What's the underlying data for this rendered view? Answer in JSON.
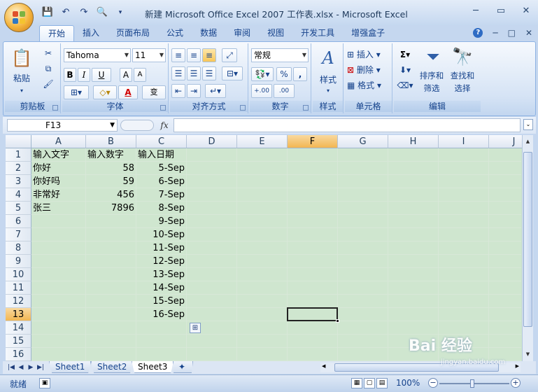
{
  "window": {
    "title": "新建 Microsoft Office Excel 2007 工作表.xlsx - Microsoft Excel",
    "min": "─",
    "max": "▭",
    "close": "✕"
  },
  "qat": [
    "save-icon",
    "undo-icon",
    "redo-icon",
    "preview-icon",
    "customize-icon"
  ],
  "tabs": [
    "开始",
    "插入",
    "页面布局",
    "公式",
    "数据",
    "审阅",
    "视图",
    "开发工具",
    "增强盒子"
  ],
  "ribbon_right": {
    "help": "?",
    "min": "─",
    "restore": "□",
    "close": "✕"
  },
  "ribbon": {
    "clipboard": {
      "label": "剪贴板",
      "paste": "粘贴"
    },
    "font": {
      "label": "字体",
      "name": "Tahoma",
      "size": "11",
      "bold": "B",
      "italic": "I",
      "underline": "U",
      "grow": "A",
      "shrink": "A",
      "color_a": "A",
      "phonetic": "变"
    },
    "alignment": {
      "label": "对齐方式"
    },
    "number": {
      "label": "数字",
      "format": "常规",
      "percent": "%",
      "comma": ",",
      "inc": ".00",
      "dec": ".00"
    },
    "styles": {
      "label": "样式"
    },
    "cells": {
      "label": "单元格",
      "insert": "插入",
      "delete": "删除",
      "format": "格式"
    },
    "editing": {
      "label": "编辑",
      "sort": "排序和",
      "sort2": "筛选",
      "find": "查找和",
      "find2": "选择"
    }
  },
  "formula_bar": {
    "name_box": "F13",
    "fx": "fx",
    "formula": ""
  },
  "columns": [
    "A",
    "B",
    "C",
    "D",
    "E",
    "F",
    "G",
    "H",
    "I",
    "J"
  ],
  "rows": [
    "1",
    "2",
    "3",
    "4",
    "5",
    "6",
    "7",
    "8",
    "9",
    "10",
    "11",
    "12",
    "13",
    "14",
    "15",
    "16"
  ],
  "selected": {
    "col": "F",
    "row": "13"
  },
  "cells": {
    "A1": "输入文字",
    "B1": "输入数字",
    "C1": "输入日期",
    "A2": "你好",
    "B2": "58",
    "C2": "5-Sep",
    "A3": "你好吗",
    "B3": "59",
    "C3": "6-Sep",
    "A4": "非常好",
    "B4": "456",
    "C4": "7-Sep",
    "A5": "张三",
    "B5": "7896",
    "C5": "8-Sep",
    "C6": "9-Sep",
    "C7": "10-Sep",
    "C8": "11-Sep",
    "C9": "12-Sep",
    "C10": "13-Sep",
    "C11": "14-Sep",
    "C12": "15-Sep",
    "C13": "16-Sep"
  },
  "sheets": [
    "Sheet1",
    "Sheet2",
    "Sheet3"
  ],
  "active_sheet": "Sheet3",
  "status": {
    "ready": "就绪",
    "zoom": "100%",
    "minus": "−",
    "plus": "+"
  },
  "watermark": {
    "brand": "Bai 经验",
    "url": "jingyan.baidu.com"
  },
  "colors": {
    "sheet_bg": "#cfe6cf",
    "selected_header": "#f2b652",
    "ribbon_text": "#15428b"
  }
}
